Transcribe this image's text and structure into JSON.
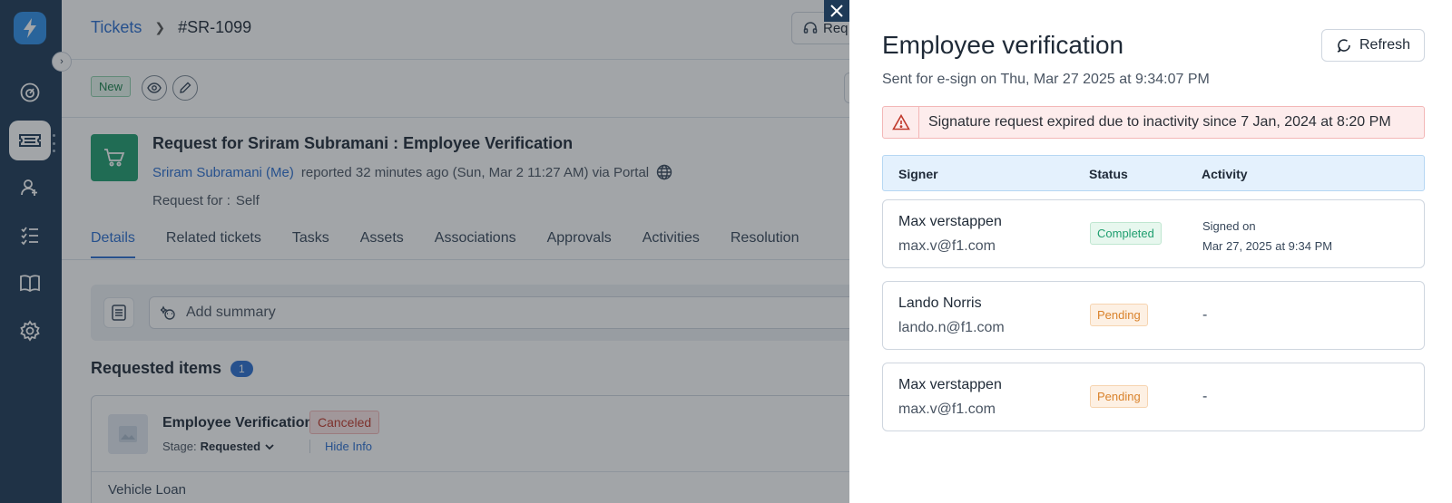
{
  "breadcrumb": {
    "root": "Tickets",
    "current": "#SR-1099"
  },
  "header": {
    "request_button_label": "Req"
  },
  "ticket": {
    "status_badge": "New",
    "title": "Request for Sriram Subramani : Employee Verification",
    "requester": "Sriram Subramani (Me)",
    "reported_text": "reported 32 minutes ago (Sun, Mar 2 11:27 AM) via Portal",
    "request_for_label": "Request for :",
    "request_for_value": "Self"
  },
  "tabs": [
    "Details",
    "Related tickets",
    "Tasks",
    "Assets",
    "Associations",
    "Approvals",
    "Activities",
    "Resolution"
  ],
  "summary": {
    "placeholder": "Add summary"
  },
  "requested_items": {
    "title": "Requested items",
    "count": "1",
    "item_name": "Employee Verification",
    "item_status": "Canceled",
    "stage_label": "Stage:",
    "stage_value": "Requested",
    "hide_info": "Hide Info",
    "detail": "Vehicle Loan"
  },
  "drawer": {
    "title": "Employee verification",
    "subtitle": "Sent for e-sign on Thu, Mar 27 2025 at 9:34:07 PM",
    "refresh_label": "Refresh",
    "alert_text": "Signature request expired due to inactivity since 7 Jan, 2024 at 8:20 PM",
    "columns": {
      "signer": "Signer",
      "status": "Status",
      "activity": "Activity"
    },
    "signers": [
      {
        "name": "Max verstappen",
        "email": "max.v@f1.com",
        "status": "Completed",
        "activity_line1": "Signed on",
        "activity_line2": "Mar 27, 2025 at 9:34 PM"
      },
      {
        "name": "Lando Norris",
        "email": "lando.n@f1.com",
        "status": "Pending",
        "activity": "-"
      },
      {
        "name": "Max verstappen",
        "email": "max.v@f1.com",
        "status": "Pending",
        "activity": "-"
      }
    ]
  },
  "colors": {
    "accent": "#2c6fd1",
    "nav_bg": "#1e3a57",
    "success": "#1f9e6f",
    "warning": "#d9822b",
    "danger": "#c0392b"
  }
}
